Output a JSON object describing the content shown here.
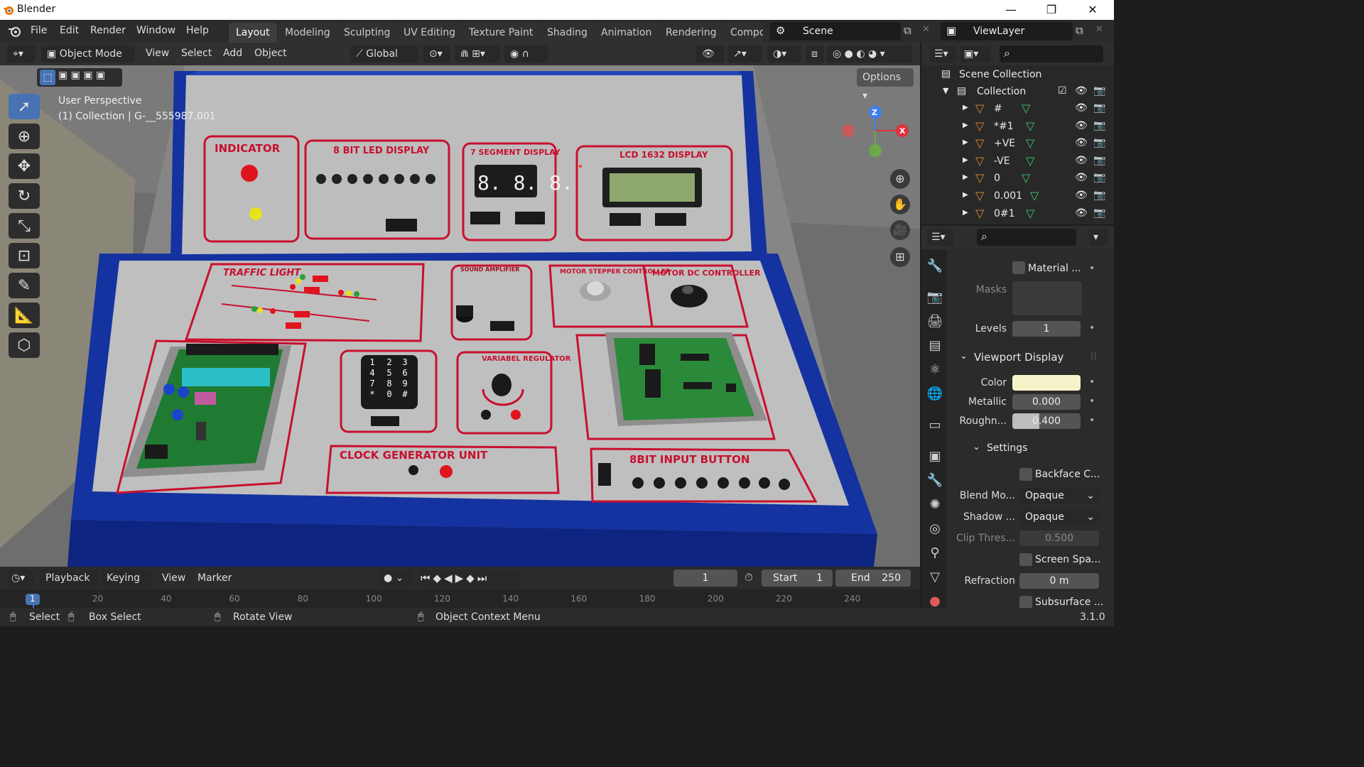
{
  "window": {
    "app_title": "Blender",
    "minimize": "—",
    "maximize": "❐",
    "close": "✕"
  },
  "menubar": {
    "menus": [
      "File",
      "Edit",
      "Render",
      "Window",
      "Help"
    ],
    "workspace_tabs": [
      "Layout",
      "Modeling",
      "Sculpting",
      "UV Editing",
      "Texture Paint",
      "Shading",
      "Animation",
      "Rendering",
      "Compo"
    ],
    "active_tab": "Layout",
    "scene_name": "Scene",
    "view_layer": "ViewLayer"
  },
  "viewport_header": {
    "mode": "Object Mode",
    "menus": [
      "View",
      "Select",
      "Add",
      "Object"
    ],
    "transform_orientation": "Global",
    "options_label": "Options"
  },
  "viewport": {
    "perspective_label": "User Perspective",
    "collection_label": "(1) Collection | G-__555987.001",
    "gizmo_axes": {
      "z": "Z",
      "x": "X"
    }
  },
  "scene_labels": {
    "indicator": "INDICATOR",
    "led_display": "8 BIT LED DISPLAY",
    "seven_segment": "7 SEGMENT DISPLAY",
    "seven_segment_digits": "8. 8. 8.",
    "lcd": "LCD 1632 DISPLAY",
    "traffic_light": "TRAFFIC LIGHT",
    "sound_amplifier": "SOUND AMPLIFIER",
    "motor_stepper": "MOTOR STEPPER CONTROLLER",
    "motor_dc": "MOTOR DC CONTROLLER",
    "variabel_regulator": "VARIABEL REGULATOR",
    "clock_generator": "CLOCK GENERATOR UNIT",
    "input_button": "8BIT INPUT BUTTON",
    "keypad_keys": [
      "1",
      "2",
      "3",
      "4",
      "5",
      "6",
      "7",
      "8",
      "9",
      "*",
      "0",
      "#"
    ]
  },
  "outliner": {
    "scene_collection": "Scene Collection",
    "collection": "Collection",
    "items": [
      "#",
      "*#1",
      "+VE",
      "-VE",
      "0",
      "0.001",
      "0#1"
    ]
  },
  "properties": {
    "material_label": "Material ...",
    "masks_label": "Masks",
    "levels_label": "Levels",
    "levels_value": "1",
    "viewport_display": "Viewport Display",
    "color_label": "Color",
    "color_value": "#f5f3c9",
    "metallic_label": "Metallic",
    "metallic_value": "0.000",
    "roughness_label": "Roughn...",
    "roughness_value": "0.400",
    "roughness_fraction": 0.4,
    "settings": "Settings",
    "backface_label": "Backface C...",
    "blend_mode_label": "Blend Mo...",
    "blend_mode_value": "Opaque",
    "shadow_label": "Shadow ...",
    "shadow_value": "Opaque",
    "clip_label": "Clip Thres...",
    "clip_value": "0.500",
    "screen_space_label": "Screen Spa...",
    "refraction_label": "Refraction",
    "refraction_value": "0 m",
    "subsurface_label": "Subsurface ..."
  },
  "timeline": {
    "playback": "Playback",
    "keying": "Keying",
    "view": "View",
    "marker": "Marker",
    "current_frame": "1",
    "start_label": "Start",
    "start_value": "1",
    "end_label": "End",
    "end_value": "250",
    "ruler": [
      "1",
      "20",
      "40",
      "60",
      "80",
      "100",
      "120",
      "140",
      "160",
      "180",
      "200",
      "220",
      "240"
    ]
  },
  "statusbar": {
    "select": "Select",
    "box_select": "Box Select",
    "rotate_view": "Rotate View",
    "context_menu": "Object Context Menu",
    "version": "3.1.0"
  }
}
